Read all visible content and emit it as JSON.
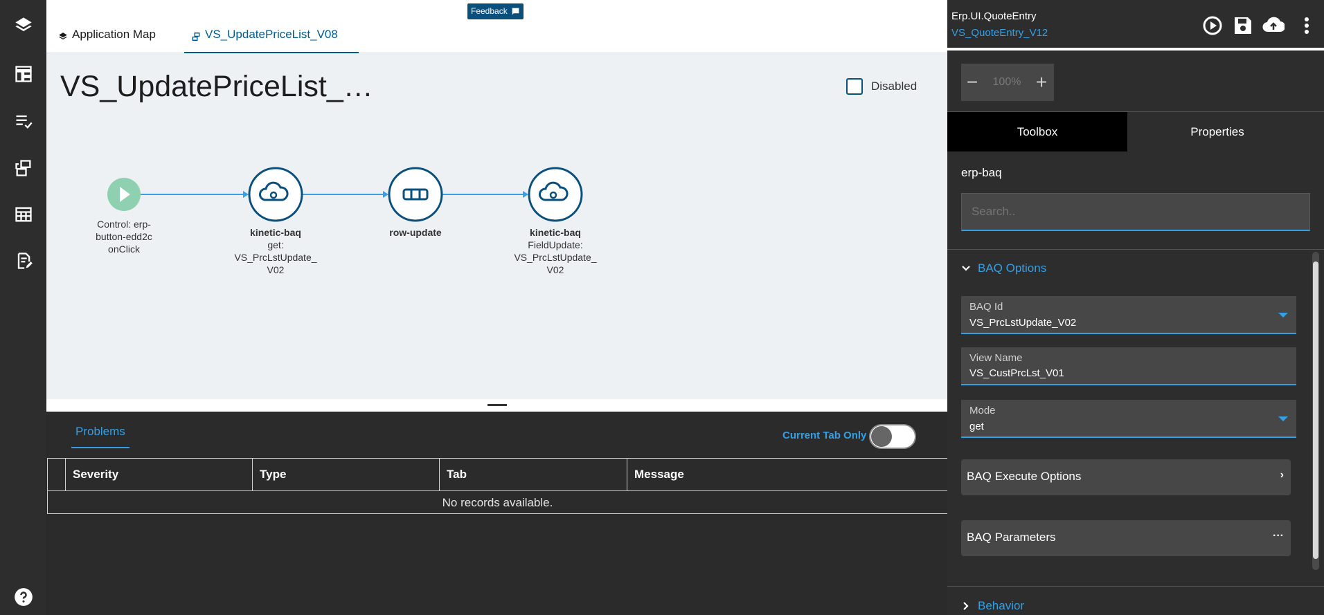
{
  "rail": {
    "items": [
      {
        "name": "layers-icon"
      },
      {
        "name": "dashboard-icon"
      },
      {
        "name": "checklist-icon"
      },
      {
        "name": "workflow-icon"
      },
      {
        "name": "table-icon"
      },
      {
        "name": "edit-document-icon"
      },
      {
        "name": "help-icon"
      }
    ]
  },
  "tabs": {
    "app_map": "Application Map",
    "active": "VS_UpdatePriceList_V08"
  },
  "feedback": {
    "label": "Feedback"
  },
  "canvas": {
    "title": "VS_UpdatePriceList_…",
    "disabled_label": "Disabled",
    "nodes": [
      {
        "kind": "start",
        "lines": [
          "Control: erp-",
          "button-edd2c",
          "onClick"
        ],
        "title": ""
      },
      {
        "kind": "cloud",
        "title": "kinetic-baq",
        "lines": [
          "get:",
          "VS_PrcLstUpdate_",
          "V02"
        ]
      },
      {
        "kind": "row",
        "title": "row-update",
        "lines": []
      },
      {
        "kind": "cloud",
        "title": "kinetic-baq",
        "lines": [
          "FieldUpdate:",
          "VS_PrcLstUpdate_",
          "V02"
        ]
      }
    ]
  },
  "problems": {
    "tab_label": "Problems",
    "current_tab_only": "Current Tab Only",
    "columns": [
      "Severity",
      "Type",
      "Tab",
      "Message"
    ],
    "empty_text": "No records available."
  },
  "right": {
    "app_name": "Erp.UI.QuoteEntry",
    "version": "VS_QuoteEntry_V12",
    "zoom": {
      "minus": "−",
      "value": "100%",
      "plus": "+"
    },
    "tabs": {
      "toolbox": "Toolbox",
      "properties": "Properties"
    },
    "section_name": "erp-baq",
    "search_placeholder": "Search..",
    "baq_options": "BAQ Options",
    "fields": {
      "baq_id": {
        "label": "BAQ Id",
        "value": "VS_PrcLstUpdate_V02"
      },
      "view_name": {
        "label": "View Name",
        "value": "VS_CustPrcLst_V01"
      },
      "mode": {
        "label": "Mode",
        "value": "get"
      }
    },
    "execute_options": "BAQ Execute Options",
    "parameters": "BAQ Parameters",
    "behavior": "Behavior"
  },
  "colors": {
    "accent": "#33a0e6",
    "node_border": "#0b4f7c",
    "start_fill": "#8fd0b0",
    "edge": "#3aa0e6"
  }
}
